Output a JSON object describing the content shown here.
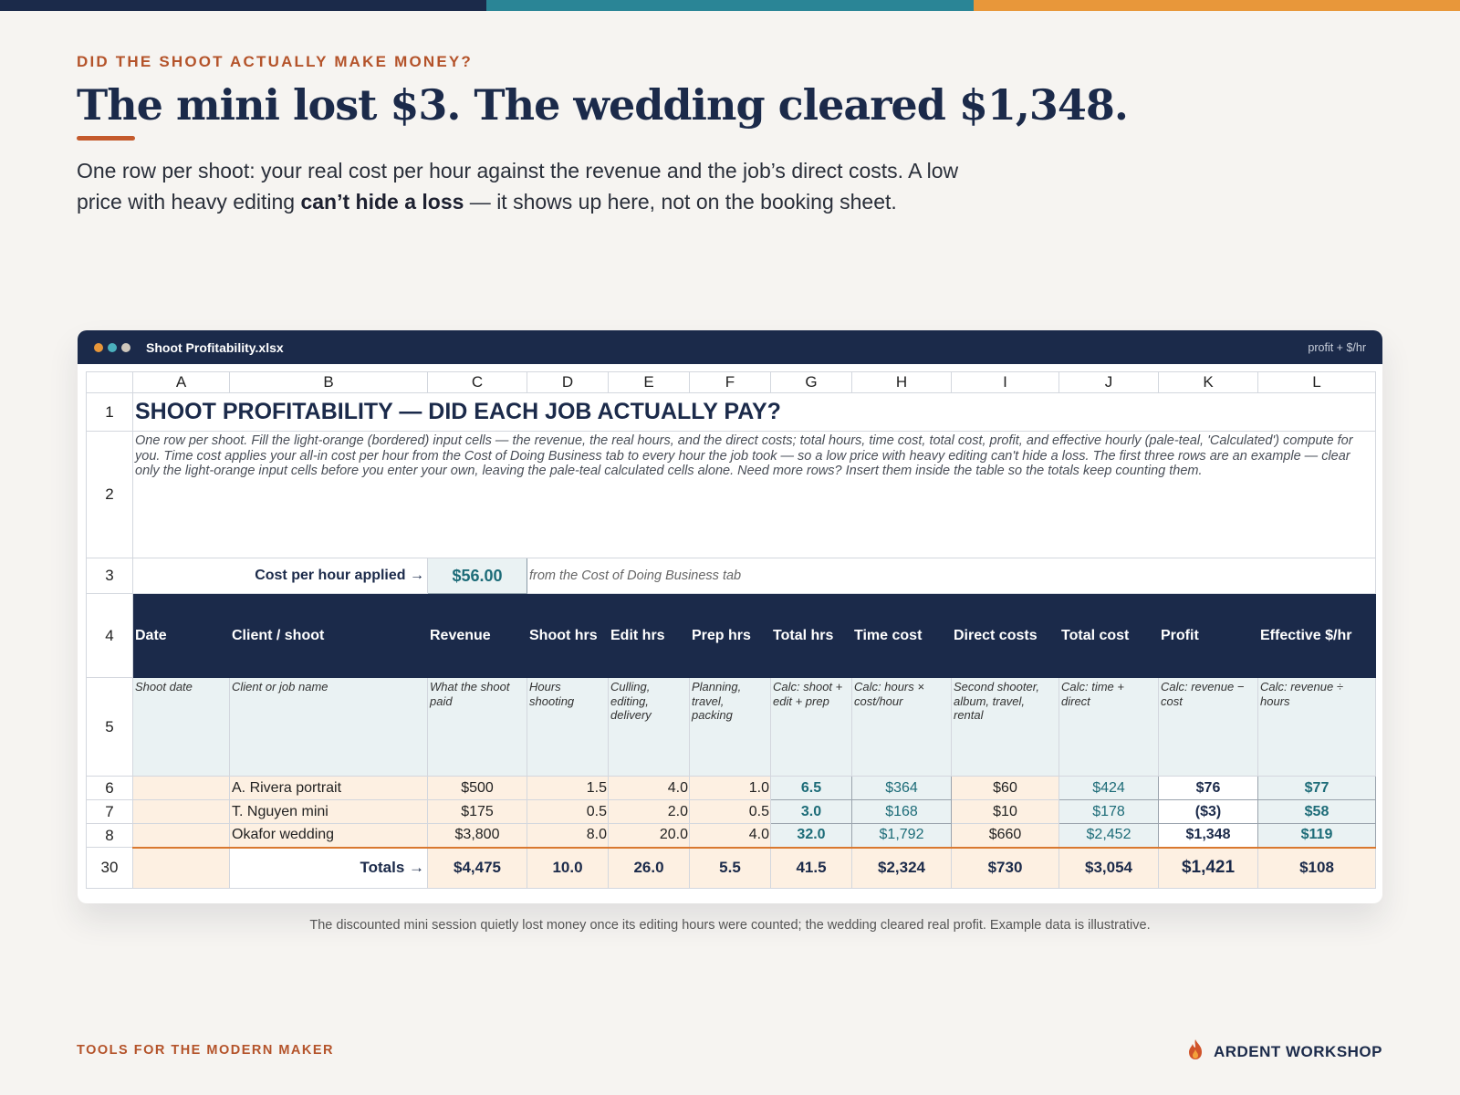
{
  "colors": {
    "navy": "#1b2a4a",
    "teal": "#2a8596",
    "orange": "#e8973a",
    "rust": "#b4532a"
  },
  "header": {
    "eyebrow": "DID THE SHOOT ACTUALLY MAKE MONEY?",
    "headline": "The mini lost $3. The wedding cleared $1,348.",
    "lede_part1": "One row per shoot: your real cost per hour against the revenue and the job’s direct costs. A low price with heavy editing ",
    "lede_bold": "can’t hide a loss",
    "lede_part2": " — it shows up here, not on the booking sheet."
  },
  "window": {
    "filename": "Shoot Profitability.xlsx",
    "tag": "profit + $/hr",
    "dot_colors": [
      "#e8973a",
      "#4bb0bd",
      "#cfc8bd"
    ]
  },
  "sheet": {
    "column_letters": [
      "A",
      "B",
      "C",
      "D",
      "E",
      "F",
      "G",
      "H",
      "I",
      "J",
      "K",
      "L"
    ],
    "row_numbers": [
      "1",
      "2",
      "3",
      "4",
      "5",
      "6",
      "7",
      "8",
      "30"
    ],
    "title": "SHOOT PROFITABILITY — DID EACH JOB ACTUALLY PAY?",
    "instructions": "One row per shoot. Fill the light-orange (bordered) input cells — the revenue, the real hours, and the direct costs; total hours, time cost, total cost, profit, and effective hourly (pale-teal, 'Calculated') compute for you. Time cost applies your all-in cost per hour from the Cost of Doing Business tab to every hour the job took — so a low price with heavy editing can't hide a loss. The first three rows are an example — clear only the light-orange input cells before you enter your own, leaving the pale-teal calculated cells alone. Need more rows? Insert them inside the table so the totals keep counting them.",
    "cost_per_hour_label": "Cost per hour applied →",
    "cost_per_hour_value": "$56.00",
    "cost_per_hour_note": "from the Cost of Doing Business tab",
    "headers": [
      "Date",
      "Client / shoot",
      "Revenue",
      "Shoot hrs",
      "Edit hrs",
      "Prep hrs",
      "Total hrs",
      "Time cost",
      "Direct costs",
      "Total cost",
      "Profit",
      "Effective $/hr"
    ],
    "hints": [
      "Shoot date",
      "Client or job name",
      "What the shoot paid",
      "Hours shooting",
      "Culling, editing, delivery",
      "Planning, travel, packing",
      "Calc: shoot + edit + prep",
      "Calc: hours × cost/hour",
      "Second shooter, album, travel, rental",
      "Calc: time + direct",
      "Calc: revenue − cost",
      "Calc: revenue ÷ hours"
    ],
    "rows": [
      {
        "date": "",
        "client": "A. Rivera portrait",
        "revenue": "$500",
        "shoot": "1.5",
        "edit": "4.0",
        "prep": "1.0",
        "total_hrs": "6.5",
        "time_cost": "$364",
        "direct": "$60",
        "total_cost": "$424",
        "profit": "$76",
        "eff": "$77"
      },
      {
        "date": "",
        "client": "T. Nguyen mini",
        "revenue": "$175",
        "shoot": "0.5",
        "edit": "2.0",
        "prep": "0.5",
        "total_hrs": "3.0",
        "time_cost": "$168",
        "direct": "$10",
        "total_cost": "$178",
        "profit": "($3)",
        "eff": "$58"
      },
      {
        "date": "",
        "client": "Okafor wedding",
        "revenue": "$3,800",
        "shoot": "8.0",
        "edit": "20.0",
        "prep": "4.0",
        "total_hrs": "32.0",
        "time_cost": "$1,792",
        "direct": "$660",
        "total_cost": "$2,452",
        "profit": "$1,348",
        "eff": "$119"
      }
    ],
    "totals": {
      "label": "Totals →",
      "revenue": "$4,475",
      "shoot": "10.0",
      "edit": "26.0",
      "prep": "5.5",
      "total_hrs": "41.5",
      "time_cost": "$2,324",
      "direct": "$730",
      "total_cost": "$3,054",
      "profit": "$1,421",
      "eff": "$108"
    }
  },
  "caption": "The discounted mini session quietly lost money once its editing hours were counted; the wedding cleared real profit. Example data is illustrative.",
  "footer": {
    "left": "TOOLS FOR THE MODERN MAKER",
    "brand": "ARDENT WORKSHOP",
    "brand_icon": "flame-icon"
  }
}
